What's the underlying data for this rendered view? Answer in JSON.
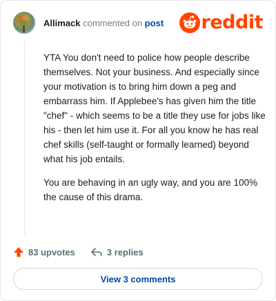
{
  "header": {
    "username": "Allimack",
    "action_text": "commented on",
    "post_link": "post",
    "brand": "reddit"
  },
  "comment": {
    "paragraphs": [
      "YTA You don't need to police how people describe themselves. Not your business. And especially since your motivation is to bring him down a peg and embarrass him. If Applebee's has given him the title \"chef\" - which seems to be a title they use for jobs like his - then let him use it. For all you know he has real chef skills (self-taught or formally learned) beyond what his job entails.",
      "You are behaving in an ugly way, and you are 100% the cause of this drama."
    ]
  },
  "actions": {
    "upvotes": "83 upvotes",
    "replies": "3 replies"
  },
  "view_comments_label": "View 3 comments",
  "colors": {
    "brand": "#ff4500",
    "link": "#0045ac",
    "muted": "#576f76"
  },
  "icons": {
    "upvote": "upvote-arrow-icon",
    "reply": "reply-arrow-icon",
    "logo": "reddit-snoo-icon"
  }
}
